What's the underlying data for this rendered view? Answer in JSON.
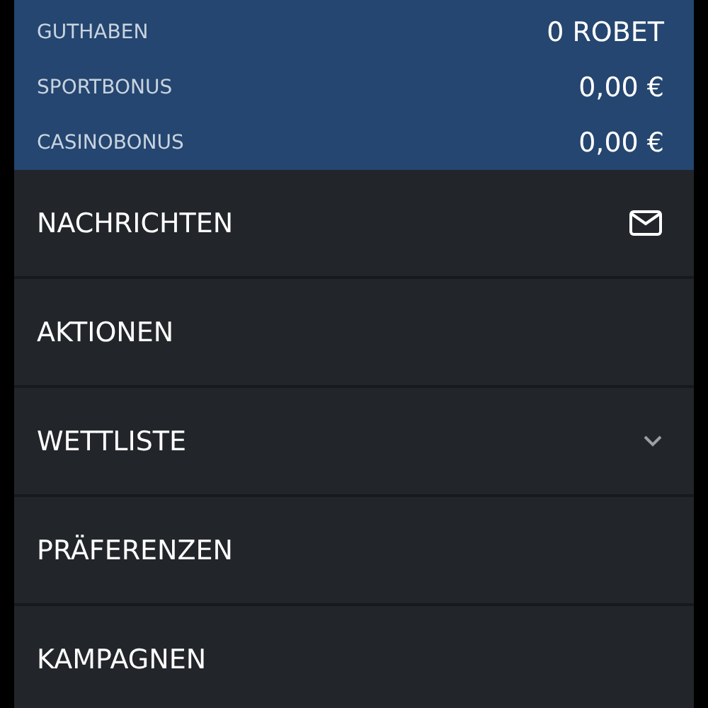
{
  "balances": [
    {
      "label": "GUTHABEN",
      "value": "0 ROBET"
    },
    {
      "label": "SPORTBONUS",
      "value": "0,00 €"
    },
    {
      "label": "CASINOBONUS",
      "value": "0,00 €"
    }
  ],
  "menu": [
    {
      "label": "NACHRICHTEN",
      "kind": "mail"
    },
    {
      "label": "AKTIONEN",
      "kind": "plain"
    },
    {
      "label": "WETTLISTE",
      "kind": "expand",
      "expanded": false
    },
    {
      "label": "PRÄFERENZEN",
      "kind": "plain"
    },
    {
      "label": "KAMPAGNEN",
      "kind": "plain"
    }
  ]
}
